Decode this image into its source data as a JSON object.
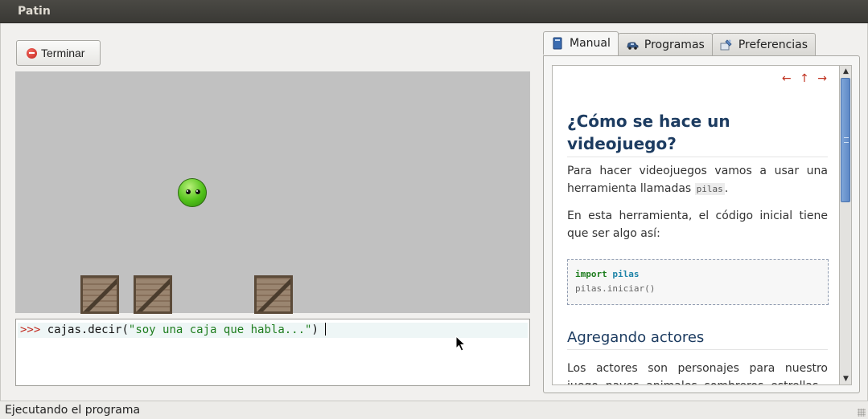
{
  "window": {
    "title": "Patin"
  },
  "toolbar": {
    "stop_label": "Terminar"
  },
  "console": {
    "prompt": ">>>",
    "command": "cajas.decir",
    "open_paren": "(",
    "argument": "\"soy una caja que habla...\"",
    "close_paren": ")"
  },
  "tabs": [
    {
      "label": "Manual",
      "icon": "book-icon",
      "active": true
    },
    {
      "label": "Programas",
      "icon": "car-icon",
      "active": false
    },
    {
      "label": "Preferencias",
      "icon": "preferences-icon",
      "active": false
    }
  ],
  "manual": {
    "nav_arrows": "← ↑ →",
    "title": "¿Cómo se hace un videojuego?",
    "para1_before": "Para hacer videojuegos vamos a usar una herramienta llamadas ",
    "para1_code": "pilas",
    "para1_after": ".",
    "para2": "En esta herramienta, el código inicial tiene que ser algo así:",
    "code_keyword": "import",
    "code_module": "pilas",
    "code_line2": "pilas.iniciar()",
    "section_title": "Agregando actores",
    "para3": "Los actores son personajes para nuestro juego, naves, animales, sombreros, estrellas"
  },
  "status": {
    "text": "Ejecutando el programa"
  },
  "colors": {
    "titlebar": "#3f3e3a",
    "canvas": "#c1c1c1",
    "heading": "#1d3c61",
    "prompt": "#c0261b",
    "string": "#1e7d1e",
    "scroll_thumb": "#5d88c6"
  }
}
